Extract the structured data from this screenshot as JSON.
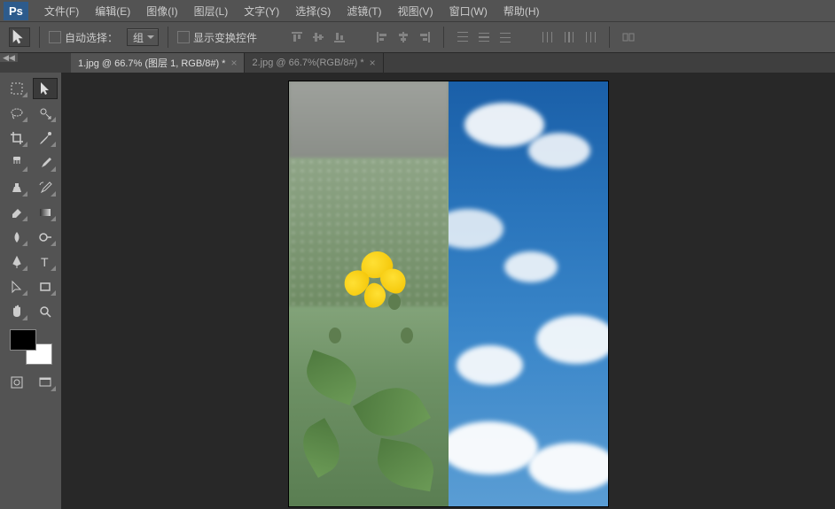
{
  "menu": {
    "file": "文件(F)",
    "edit": "编辑(E)",
    "image": "图像(I)",
    "layer": "图层(L)",
    "type": "文字(Y)",
    "select": "选择(S)",
    "filter": "滤镜(T)",
    "view": "视图(V)",
    "window": "窗口(W)",
    "help": "帮助(H)"
  },
  "options": {
    "auto_select": "自动选择：",
    "group": "组",
    "show_transform": "显示变换控件"
  },
  "tabs": [
    {
      "label": "1.jpg @ 66.7% (图层 1, RGB/8#) *",
      "active": true
    },
    {
      "label": "2.jpg @ 66.7%(RGB/8#) *",
      "active": false
    }
  ],
  "colors": {
    "fg": "#000000",
    "bg": "#ffffff"
  }
}
